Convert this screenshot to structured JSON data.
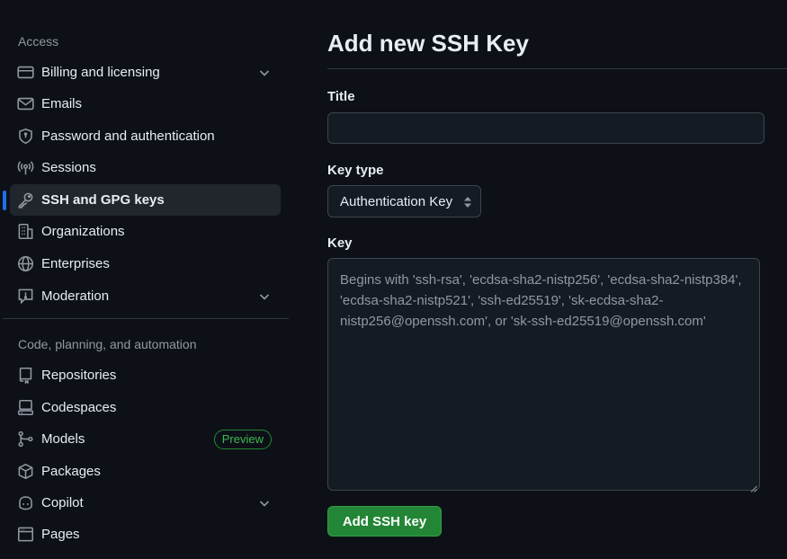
{
  "sidebar": {
    "access_title": "Access",
    "access_items": [
      {
        "label": "Billing and licensing",
        "icon": "credit-card-icon",
        "expandable": true
      },
      {
        "label": "Emails",
        "icon": "mail-icon"
      },
      {
        "label": "Password and authentication",
        "icon": "shield-lock-icon"
      },
      {
        "label": "Sessions",
        "icon": "broadcast-icon"
      },
      {
        "label": "SSH and GPG keys",
        "icon": "key-icon",
        "active": true
      },
      {
        "label": "Organizations",
        "icon": "organization-icon"
      },
      {
        "label": "Enterprises",
        "icon": "globe-icon"
      },
      {
        "label": "Moderation",
        "icon": "report-icon",
        "expandable": true
      }
    ],
    "code_title": "Code, planning, and automation",
    "code_items": [
      {
        "label": "Repositories",
        "icon": "repo-icon"
      },
      {
        "label": "Codespaces",
        "icon": "codespaces-icon"
      },
      {
        "label": "Models",
        "icon": "models-icon",
        "badge": "Preview"
      },
      {
        "label": "Packages",
        "icon": "package-icon"
      },
      {
        "label": "Copilot",
        "icon": "copilot-icon",
        "expandable": true
      },
      {
        "label": "Pages",
        "icon": "browser-icon"
      }
    ]
  },
  "main": {
    "title": "Add new SSH Key",
    "title_field_label": "Title",
    "title_field_value": "",
    "key_type_label": "Key type",
    "key_type_value": "Authentication Key",
    "key_label": "Key",
    "key_placeholder": "Begins with 'ssh-rsa', 'ecdsa-sha2-nistp256', 'ecdsa-sha2-nistp384', 'ecdsa-sha2-nistp521', 'ssh-ed25519', 'sk-ecdsa-sha2-nistp256@openssh.com', or 'sk-ssh-ed25519@openssh.com'",
    "submit_label": "Add SSH key"
  },
  "colors": {
    "background": "#0d1117",
    "active_item": "#21262d",
    "accent_blue": "#1f6feb",
    "primary_green": "#238636",
    "badge_green": "#3fb950",
    "muted_text": "#9198a1"
  }
}
